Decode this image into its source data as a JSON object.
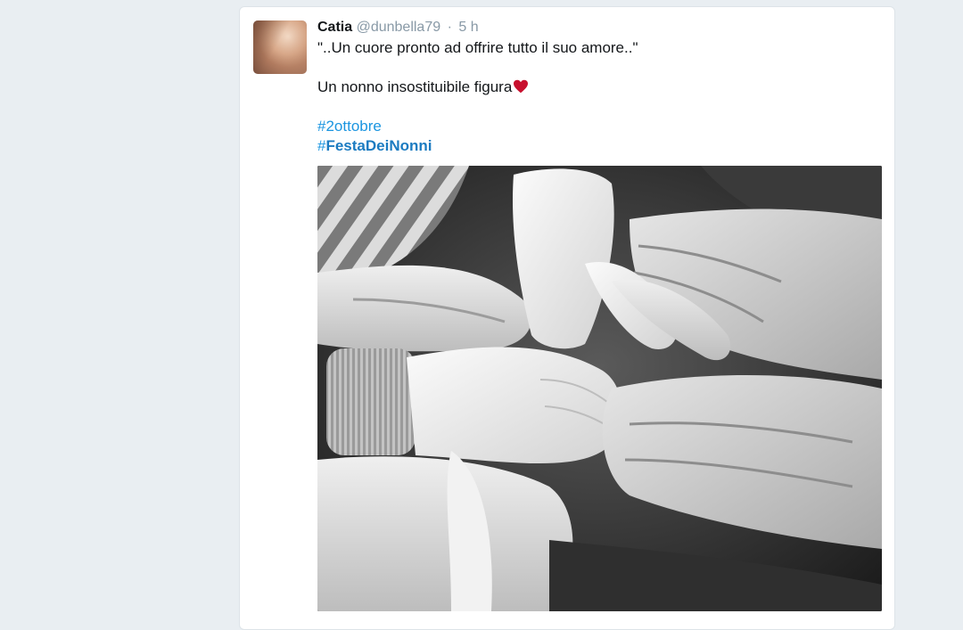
{
  "tweet": {
    "author_name": "Catia",
    "author_handle": "@dunbella79",
    "separator": "·",
    "time": "5 h",
    "line1": "\"..Un cuore pronto ad offrire tutto il suo amore..\"",
    "line2": "Un nonno insostituibile figura",
    "hashtag1_hash": "#",
    "hashtag1_text": "2ottobre",
    "hashtag2_hash": "#",
    "hashtag2_text": "FestaDeiNonni",
    "heart_emoji": "red-heart-icon"
  },
  "colors": {
    "link": "#1b95e0",
    "name": "#14171a",
    "meta": "#8899a6",
    "heart": "#e0245e"
  }
}
